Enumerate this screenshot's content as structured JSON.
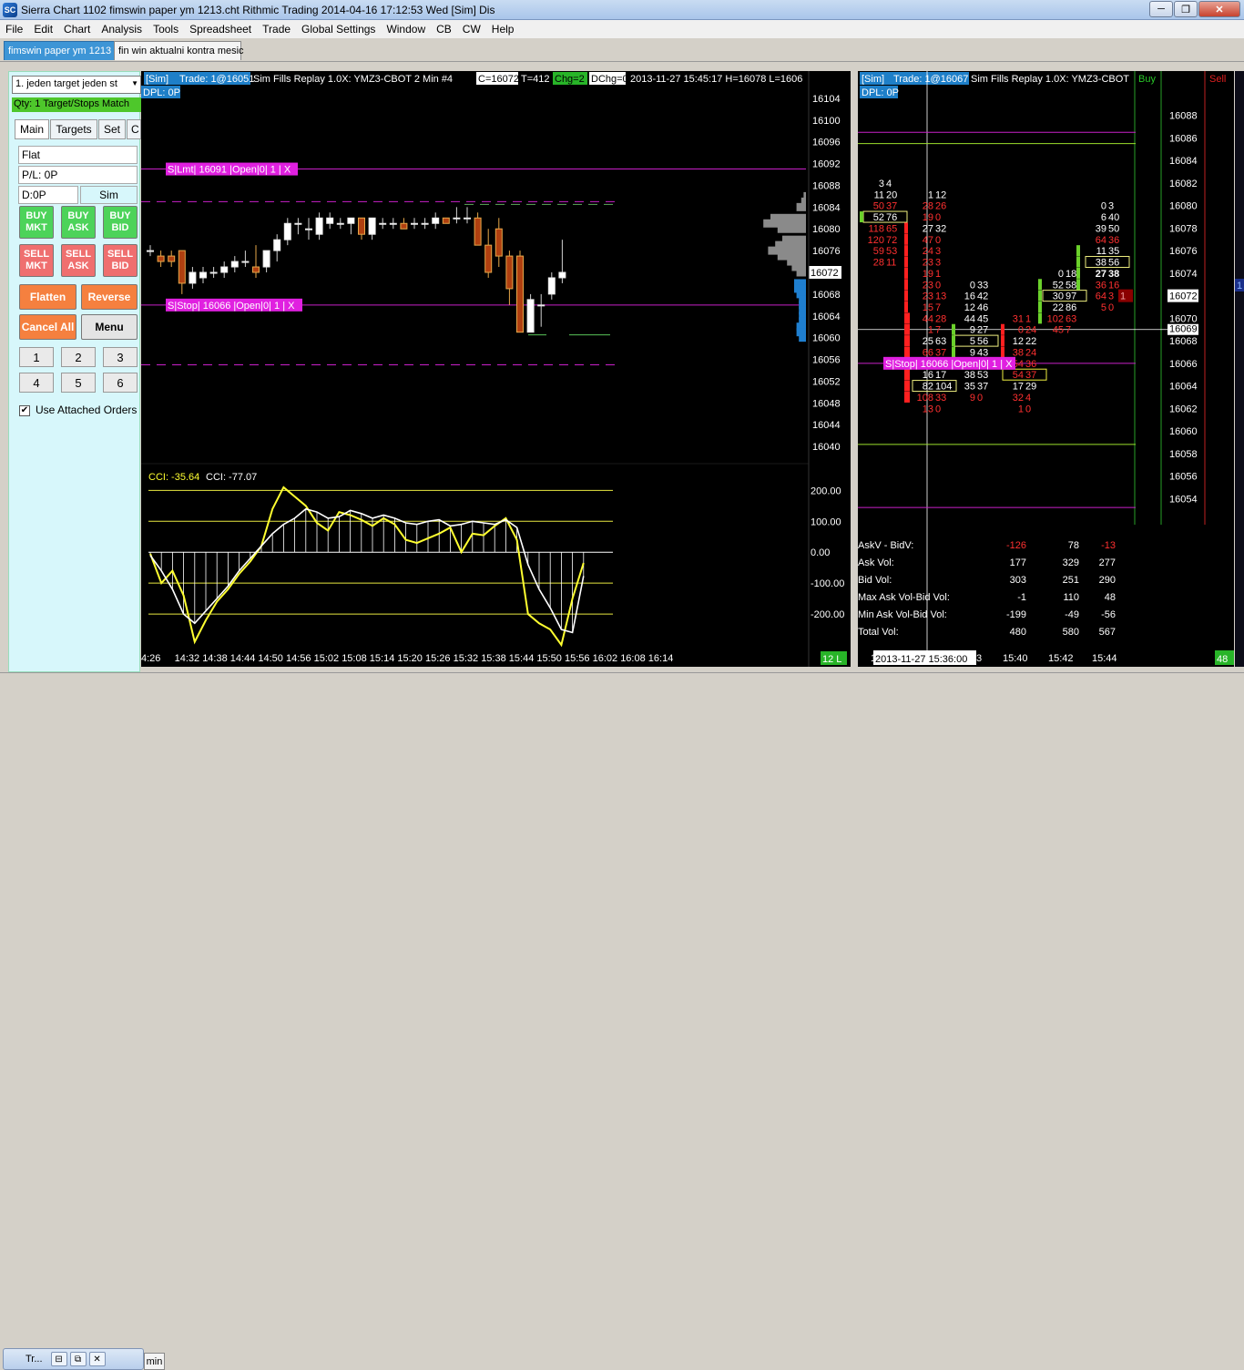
{
  "window": {
    "title": "Sierra Chart 1102 fimswin paper ym 1213.cht  Rithmic Trading 2014-04-16  17:12:53 Wed [Sim]  Dis",
    "app_icon": "SC"
  },
  "menu": [
    "File",
    "Edit",
    "Chart",
    "Analysis",
    "Tools",
    "Spreadsheet",
    "Trade",
    "Global Settings",
    "Window",
    "CB",
    "CW",
    "Help"
  ],
  "tabs": [
    "fimswin paper ym 1213",
    "fin win aktualni kontra mesic"
  ],
  "trade_panel": {
    "strategy": "1. jeden target jeden st",
    "qty": "Qty: 1 Target/Stops Match",
    "tabs": [
      "Main",
      "Targets",
      "Set",
      "C"
    ],
    "position": "Flat",
    "pl": "P/L: 0P",
    "daily": "D:0P",
    "mode": "Sim",
    "buy_mkt": "BUY\nMKT",
    "buy_ask": "BUY\nASK",
    "buy_bid": "BUY\nBID",
    "sell_mkt": "SELL\nMKT",
    "sell_ask": "SELL\nASK",
    "sell_bid": "SELL\nBID",
    "flatten": "Flatten",
    "reverse": "Reverse",
    "cancel_all": "Cancel All",
    "menu": "Menu",
    "numbers": [
      "1",
      "2",
      "3",
      "4",
      "5",
      "6"
    ],
    "use_attached": "Use Attached Orders",
    "checkbox_mark": "✔"
  },
  "left_chart": {
    "header": {
      "sim": "[Sim]",
      "trade": "Trade: 1@16051",
      "info": "Sim Fills  Replay 1.0X: YMZ3-CBOT  2 Min  #4",
      "c": "C=16072",
      "t": "T=412",
      "chg": "Chg=2",
      "dchg": "DChg=0",
      "date": "2013-11-27  15:45:17 H=16078 L=1606",
      "dpl": "DPL: 0P"
    },
    "order_limit": "S|Lmt| 16091 |Open|0| 1 | X",
    "order_stop": "S|Stop| 16066 |Open|0| 1 | X",
    "price_scale": [
      "16104",
      "16100",
      "16096",
      "16092",
      "16088",
      "16084",
      "16080",
      "16076",
      "16072",
      "16068",
      "16064",
      "16060",
      "16056",
      "16052",
      "16048",
      "16044",
      "16040"
    ],
    "current_price": "16072",
    "cci_label1": "CCI: -35.64",
    "cci_label2": "CCI: -77.07",
    "cci_scale": [
      "200.00",
      "100.00",
      "0.00",
      "-100.00",
      "-200.00"
    ],
    "time_axis": [
      "4:26",
      "14:32",
      "14:38",
      "14:44",
      "14:50",
      "14:56",
      "15:02",
      "15:08",
      "15:14",
      "15:20",
      "15:26",
      "15:32",
      "15:38",
      "15:44",
      "15:50",
      "15:56",
      "16:02",
      "16:08",
      "16:14"
    ],
    "badge": "12 L"
  },
  "right_chart": {
    "header": {
      "sim": "[Sim]",
      "trade": "Trade: 1@16067",
      "info": "Sim Fills  Replay 1.0X: YMZ3-CBOT",
      "dpl": "DPL: 0P",
      "buy": "Buy",
      "sell": "Sell"
    },
    "price_scale": [
      "16088",
      "16086",
      "16084",
      "16082",
      "16080",
      "16078",
      "16076",
      "16074",
      "16072",
      "16070",
      "16068",
      "16066",
      "16064",
      "16062",
      "16060",
      "16058",
      "16056",
      "16054"
    ],
    "current_price": "16072",
    "current_price2": "16069",
    "dom_level": "1",
    "dom_level_buy": "1",
    "order_stop": "S|Stop| 16066 |Open|0| 1 | X",
    "bar1": [
      {
        "p": 16082,
        "t": "3|4",
        "c": "#ffffff"
      },
      {
        "p": 16081,
        "t": "11|20",
        "c": "#ffffff"
      },
      {
        "p": 16080,
        "t": "50|37",
        "c": "#ff3030"
      },
      {
        "p": 16079,
        "t": "52|76",
        "c": "#ffffff",
        "box": true
      },
      {
        "p": 16078,
        "t": "118|65",
        "c": "#ff3030"
      },
      {
        "p": 16077,
        "t": "120|72",
        "c": "#ff3030"
      },
      {
        "p": 16076,
        "t": "59|53",
        "c": "#ff3030"
      },
      {
        "p": 16075,
        "t": "28|11",
        "c": "#ff3030"
      }
    ],
    "bar2": [
      {
        "p": 16081,
        "t": "1|12",
        "c": "#ffffff"
      },
      {
        "p": 16080,
        "t": "28|26",
        "c": "#ff3030"
      },
      {
        "p": 16079,
        "t": "19|0",
        "c": "#ff3030"
      },
      {
        "p": 16078,
        "t": "27|32",
        "c": "#ffffff"
      },
      {
        "p": 16077,
        "t": "47|0",
        "c": "#ff3030"
      },
      {
        "p": 16076,
        "t": "24|3",
        "c": "#ff3030"
      },
      {
        "p": 16075,
        "t": "23|3",
        "c": "#ff3030"
      },
      {
        "p": 16074,
        "t": "19|1",
        "c": "#ff3030"
      },
      {
        "p": 16073,
        "t": "23|0",
        "c": "#ff3030"
      },
      {
        "p": 16072,
        "t": "23|13",
        "c": "#ff3030"
      },
      {
        "p": 16071,
        "t": "15|7",
        "c": "#ff3030"
      },
      {
        "p": 16070,
        "t": "44|28",
        "c": "#ff3030"
      },
      {
        "p": 16069,
        "t": "1|7",
        "c": "#ff3030"
      },
      {
        "p": 16068,
        "t": "25|63",
        "c": "#ffffff"
      },
      {
        "p": 16067,
        "t": "66|37",
        "c": "#ff3030"
      },
      {
        "p": 16066,
        "t": "41|0",
        "c": "#ff3030"
      },
      {
        "p": 16065,
        "t": "16|17",
        "c": "#ffffff"
      },
      {
        "p": 16064,
        "t": "82|104",
        "c": "#ffffff",
        "box": true
      },
      {
        "p": 16063,
        "t": "108|33",
        "c": "#ff3030"
      },
      {
        "p": 16062,
        "t": "13|0",
        "c": "#ff3030"
      }
    ],
    "bar3": [
      {
        "p": 16073,
        "t": "0|33",
        "c": "#ffffff"
      },
      {
        "p": 16072,
        "t": "16|42",
        "c": "#ffffff"
      },
      {
        "p": 16071,
        "t": "12|46",
        "c": "#ffffff"
      },
      {
        "p": 16070,
        "t": "44|45",
        "c": "#ffffff"
      },
      {
        "p": 16069,
        "t": "9|27",
        "c": "#ffffff"
      },
      {
        "p": 16068,
        "t": "5|56",
        "c": "#ffffff",
        "box": true
      },
      {
        "p": 16067,
        "t": "9|43",
        "c": "#ffffff"
      },
      {
        "p": 16066,
        "t": "14|34",
        "c": "#ffffff"
      },
      {
        "p": 16065,
        "t": "38|53",
        "c": "#ffffff"
      },
      {
        "p": 16064,
        "t": "35|37",
        "c": "#ffffff"
      },
      {
        "p": 16063,
        "t": "9|0",
        "c": "#ff3030"
      }
    ],
    "bar4": [
      {
        "p": 16070,
        "t": "31|1",
        "c": "#ff3030"
      },
      {
        "p": 16069,
        "t": "0|24",
        "c": "#ff3030"
      },
      {
        "p": 16068,
        "t": "12|22",
        "c": "#ffffff"
      },
      {
        "p": 16067,
        "t": "38|24",
        "c": "#ff3030"
      },
      {
        "p": 16066,
        "t": "54|36",
        "c": "#ff3030"
      },
      {
        "p": 16065,
        "t": "54|37",
        "c": "#ff3030",
        "box": true
      },
      {
        "p": 16064,
        "t": "17|29",
        "c": "#ffffff"
      },
      {
        "p": 16063,
        "t": "32|4",
        "c": "#ff3030"
      },
      {
        "p": 16062,
        "t": "1|0",
        "c": "#ff3030"
      }
    ],
    "bar5": [
      {
        "p": 16074,
        "t": "0|18",
        "c": "#ffffff"
      },
      {
        "p": 16073,
        "t": "52|58",
        "c": "#ffffff"
      },
      {
        "p": 16072,
        "t": "30|97",
        "c": "#ffffff",
        "box": true
      },
      {
        "p": 16071,
        "t": "22|86",
        "c": "#ffffff"
      },
      {
        "p": 16070,
        "t": "102|63",
        "c": "#ff3030"
      },
      {
        "p": 16069,
        "t": "45|7",
        "c": "#ff3030"
      }
    ],
    "bar6": [
      {
        "p": 16080,
        "t": "0|3",
        "c": "#ffffff"
      },
      {
        "p": 16079,
        "t": "6|40",
        "c": "#ffffff"
      },
      {
        "p": 16078,
        "t": "39|50",
        "c": "#ffffff"
      },
      {
        "p": 16077,
        "t": "64|36",
        "c": "#ff3030"
      },
      {
        "p": 16076,
        "t": "11|35",
        "c": "#ffffff"
      },
      {
        "p": 16075,
        "t": "38|56",
        "c": "#ffffff",
        "box": true
      },
      {
        "p": 16074,
        "t": "27|38",
        "c": "#ffffff",
        "bold": true
      },
      {
        "p": 16073,
        "t": "36|16",
        "c": "#ff3030"
      },
      {
        "p": 16072,
        "t": "64|3",
        "c": "#ff3030"
      },
      {
        "p": 16071,
        "t": "5|0",
        "c": "#ff3030"
      }
    ],
    "stats_labels": [
      "AskV - BidV:",
      "Ask Vol:",
      "Bid Vol:",
      "Max Ask Vol-Bid Vol:",
      "Min Ask Vol-Bid Vol:",
      "Total Vol:"
    ],
    "stats_values": [
      [
        "-126",
        "78",
        "-13"
      ],
      [
        "177",
        "329",
        "277"
      ],
      [
        "303",
        "251",
        "290"
      ],
      [
        "-1",
        "110",
        "48"
      ],
      [
        "-199",
        "-49",
        "-56"
      ],
      [
        "480",
        "580",
        "567"
      ]
    ],
    "time_axis": [
      "1",
      "3",
      "15:40",
      "15:42",
      "15:44"
    ],
    "time_label": "2013-11-27  15:36:00",
    "badge": "48"
  },
  "bottom": {
    "mini_label": "Tr...",
    "minimize": "⊟",
    "restore": "⧉",
    "close": "✕",
    "min_tab": "min"
  },
  "chart_data": [
    {
      "type": "candlestick",
      "title": "",
      "ylim": [
        16038,
        16106
      ],
      "x": [
        "14:26",
        "14:28",
        "14:30",
        "14:32",
        "14:34",
        "14:36",
        "14:38",
        "14:40",
        "14:42",
        "14:44",
        "14:46",
        "14:48",
        "14:50",
        "14:52",
        "14:54",
        "14:56",
        "14:58",
        "15:00",
        "15:02",
        "15:04",
        "15:06",
        "15:08",
        "15:10",
        "15:12",
        "15:14",
        "15:16",
        "15:18",
        "15:20",
        "15:22",
        "15:24",
        "15:26",
        "15:28",
        "15:30",
        "15:32",
        "15:34",
        "15:36",
        "15:38",
        "15:40",
        "15:42",
        "15:44"
      ],
      "ohlc": [
        [
          16076,
          16077,
          16075,
          16076
        ],
        [
          16075,
          16076,
          16073,
          16074
        ],
        [
          16075,
          16076,
          16073,
          16074
        ],
        [
          16076,
          16076,
          16068,
          16070
        ],
        [
          16070,
          16073,
          16069,
          16072
        ],
        [
          16071,
          16073,
          16070,
          16072
        ],
        [
          16072,
          16073,
          16071,
          16072
        ],
        [
          16072,
          16074,
          16071,
          16073
        ],
        [
          16073,
          16075,
          16072,
          16074
        ],
        [
          16074,
          16076,
          16073,
          16074
        ],
        [
          16073,
          16077,
          16071,
          16072
        ],
        [
          16073,
          16076,
          16072,
          16076
        ],
        [
          16076,
          16079,
          16074,
          16078
        ],
        [
          16078,
          16082,
          16077,
          16081
        ],
        [
          16081,
          16082,
          16079,
          16081
        ],
        [
          16080,
          16082,
          16078,
          16080
        ],
        [
          16079,
          16083,
          16078,
          16082
        ],
        [
          16081,
          16083,
          16080,
          16082
        ],
        [
          16081,
          16082,
          16080,
          16081
        ],
        [
          16081,
          16082,
          16079,
          16082
        ],
        [
          16082,
          16082,
          16078,
          16079
        ],
        [
          16079,
          16082,
          16078,
          16082
        ],
        [
          16081,
          16082,
          16080,
          16081
        ],
        [
          16081,
          16082,
          16080,
          16081
        ],
        [
          16081,
          16082,
          16080,
          16080
        ],
        [
          16081,
          16082,
          16080,
          16081
        ],
        [
          16081,
          16082,
          16080,
          16081
        ],
        [
          16081,
          16083,
          16080,
          16082
        ],
        [
          16082,
          16082,
          16081,
          16081
        ],
        [
          16082,
          16084,
          16081,
          16082
        ],
        [
          16082,
          16084,
          16081,
          16082
        ],
        [
          16082,
          16083,
          16077,
          16077
        ],
        [
          16077,
          16080,
          16071,
          16072
        ],
        [
          16080,
          16082,
          16073,
          16075
        ],
        [
          16075,
          16076,
          16066,
          16069
        ],
        [
          16075,
          16076,
          16061,
          16061
        ],
        [
          16061,
          16068,
          16061,
          16067
        ],
        [
          16066,
          16068,
          16062,
          16066
        ],
        [
          16068,
          16072,
          16067,
          16071
        ],
        [
          16071,
          16078,
          16070,
          16072
        ]
      ],
      "orders": [
        {
          "label": "S|Lmt| 16091",
          "price": 16091
        },
        {
          "label": "S|Stop| 16066",
          "price": 16066
        }
      ],
      "dashed_levels": [
        16085,
        16055
      ],
      "volume_profile": [
        {
          "price": 16086,
          "vol": 1
        },
        {
          "price": 16085,
          "vol": 2
        },
        {
          "price": 16084,
          "vol": 4
        },
        {
          "price": 16082,
          "vol": 15
        },
        {
          "price": 16081,
          "vol": 18
        },
        {
          "price": 16080,
          "vol": 12
        },
        {
          "price": 16078,
          "vol": 10
        },
        {
          "price": 16077,
          "vol": 13
        },
        {
          "price": 16076,
          "vol": 16
        },
        {
          "price": 16075,
          "vol": 12
        },
        {
          "price": 16074,
          "vol": 8
        },
        {
          "price": 16073,
          "vol": 6
        },
        {
          "price": 16072,
          "vol": 4
        },
        {
          "price": 16070,
          "vol": 5
        },
        {
          "price": 16069,
          "vol": 5
        },
        {
          "price": 16068,
          "vol": 4
        },
        {
          "price": 16067,
          "vol": 3
        },
        {
          "price": 16066,
          "vol": 3
        },
        {
          "price": 16065,
          "vol": 3
        },
        {
          "price": 16064,
          "vol": 3
        },
        {
          "price": 16063,
          "vol": 3
        },
        {
          "price": 16062,
          "vol": 4
        },
        {
          "price": 16061,
          "vol": 4
        },
        {
          "price": 16060,
          "vol": 3
        }
      ]
    },
    {
      "type": "line",
      "title": "",
      "ylim": [
        -250,
        280
      ],
      "series": [
        {
          "name": "CCI: -35.64",
          "color": "#ffff30",
          "values": [
            -5,
            -100,
            -60,
            -140,
            -290,
            -220,
            -160,
            -120,
            -70,
            -30,
            20,
            140,
            210,
            180,
            150,
            95,
            70,
            130,
            120,
            105,
            85,
            110,
            90,
            40,
            30,
            45,
            60,
            80,
            0,
            60,
            55,
            85,
            110,
            40,
            -200,
            -230,
            -250,
            -300,
            -150,
            -35
          ]
        },
        {
          "name": "CCI: -77.07",
          "color": "#ffffff",
          "values": [
            -10,
            -60,
            -120,
            -200,
            -230,
            -190,
            -150,
            -110,
            -60,
            -20,
            20,
            60,
            90,
            110,
            140,
            130,
            110,
            115,
            135,
            125,
            110,
            120,
            110,
            95,
            90,
            100,
            105,
            85,
            90,
            100,
            95,
            90,
            105,
            80,
            -40,
            -120,
            -180,
            -250,
            -260,
            -77
          ]
        }
      ],
      "levels": [
        200,
        100,
        0,
        -100,
        -200
      ]
    }
  ]
}
